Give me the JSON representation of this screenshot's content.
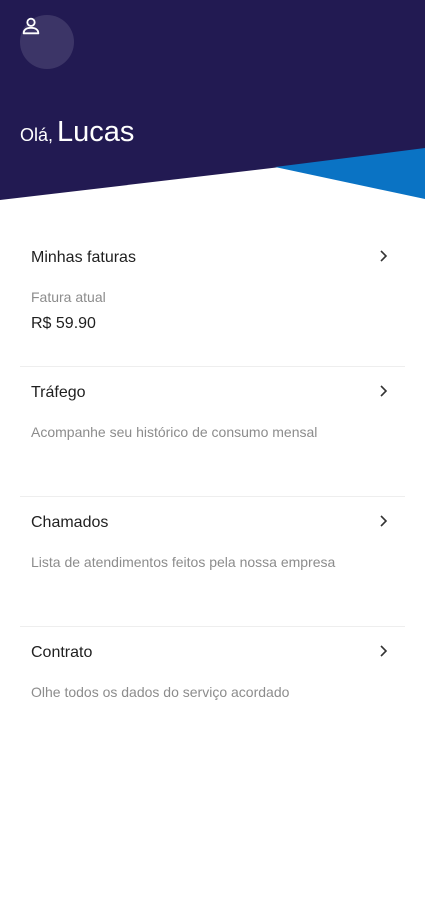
{
  "header": {
    "greeting": "Olá,",
    "user_name": "Lucas",
    "background_color": "#221a52",
    "accent_color": "#0a73c4"
  },
  "menu": {
    "faturas": {
      "title": "Minhas faturas",
      "subtitle": "Fatura atual",
      "value": "R$ 59.90"
    },
    "trafego": {
      "title": "Tráfego",
      "subtitle": "Acompanhe seu histórico de consumo mensal"
    },
    "chamados": {
      "title": "Chamados",
      "subtitle": "Lista de atendimentos feitos pela nossa empresa"
    },
    "contrato": {
      "title": "Contrato",
      "subtitle": "Olhe todos os dados do serviço acordado"
    }
  },
  "icons": {
    "profile": "user-icon",
    "chevron": "chevron-right-icon"
  }
}
